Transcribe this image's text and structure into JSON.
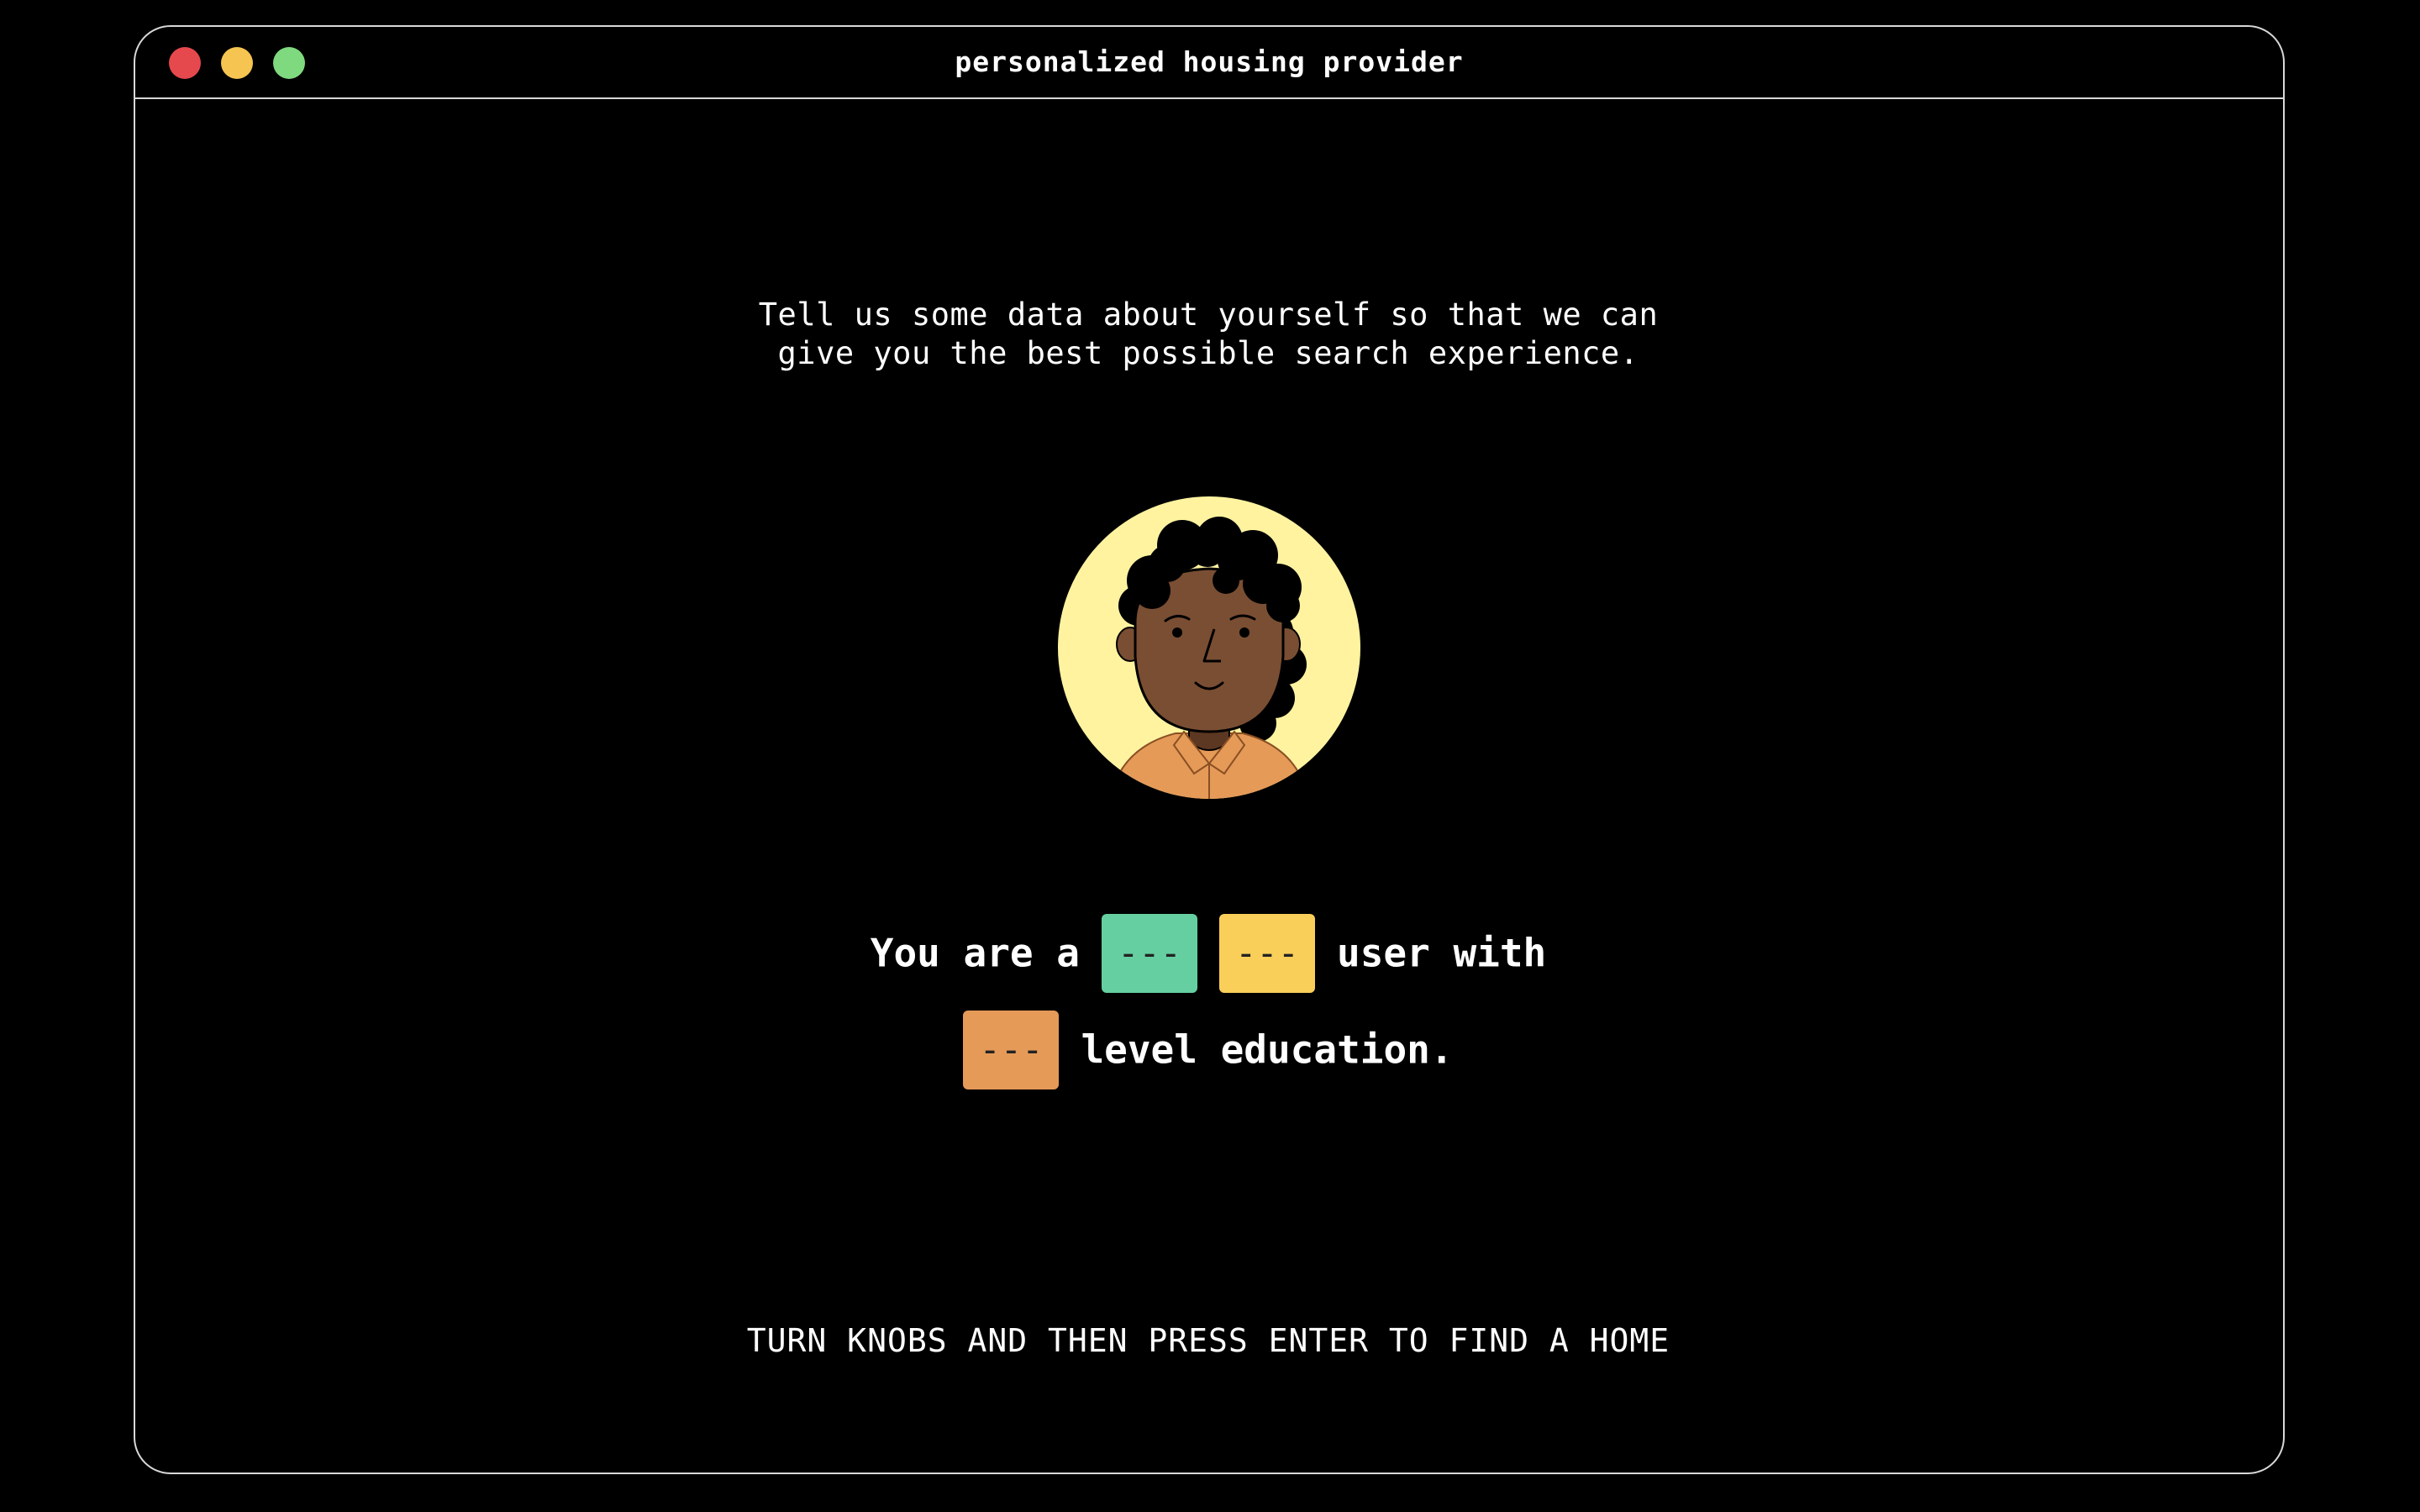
{
  "window": {
    "title": "personalized housing provider"
  },
  "intro": {
    "text": "Tell us some data about yourself so that we can\n give you the best possible search experience."
  },
  "avatar": {
    "icon": "woman-avatar-icon",
    "background_color": "#fff3a0",
    "skin_color": "#7a4e33",
    "shirt_color": "#e59a58"
  },
  "sentence": {
    "prefix": "You are a",
    "knob1": "---",
    "knob2": "---",
    "middle": "user with",
    "knob3": "---",
    "suffix": "level education."
  },
  "knob_colors": {
    "knob1": "#66cfa1",
    "knob2": "#f9cf5a",
    "knob3": "#e59a58"
  },
  "instruction": {
    "text": "TURN KNOBS AND THEN PRESS ENTER TO FIND A HOME"
  }
}
